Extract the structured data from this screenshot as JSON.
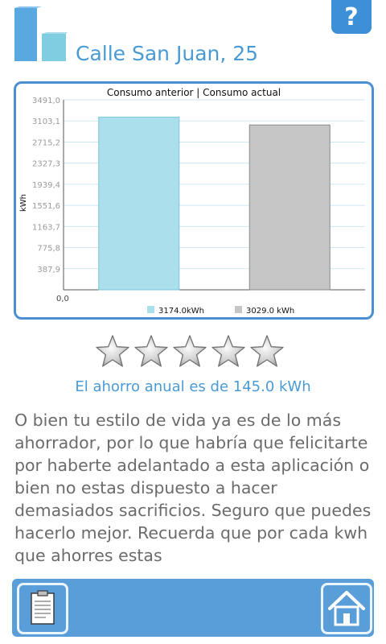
{
  "header": {
    "address": "Calle San Juan, 25",
    "help_label": "?",
    "logo_icon": "bars-logo-icon"
  },
  "chart_data": {
    "type": "bar",
    "title": "Consumo anterior | Consumo actual",
    "ylabel": "kWh",
    "ylim": [
      0,
      3491.0
    ],
    "yticks": [
      "0,0",
      "387,9",
      "775,8",
      "1163,7",
      "1551,6",
      "1939,4",
      "2327,3",
      "2715,2",
      "3103,1",
      "3491,0"
    ],
    "series": [
      {
        "name": "3174.0kWh",
        "value": 3174.0,
        "color": "#acdfec"
      },
      {
        "name": "3029.0 kWh",
        "value": 3029.0,
        "color": "#c6c6c6"
      }
    ],
    "grid": true,
    "legend": "bottom"
  },
  "rating": {
    "filled": 0,
    "max": 5,
    "icon": "star-icon"
  },
  "savings_text": "El ahorro anual es de 145.0 kWh",
  "message": "O bien tu estilo de vida ya es de lo más ahorrador, por lo que habría que felicitarte por haberte adelantado a esta aplicación o bien no estas dispuesto a hacer demasiados sacrificios. Seguro que puedes hacerlo mejor. Recuerda que por cada kwh que ahorres estas",
  "footer": {
    "left_icon": "clipboard-icon",
    "right_icon": "home-icon"
  },
  "colors": {
    "accent": "#4a9ad4",
    "bar_bg": "#5a9ed9",
    "text": "#6b6b6b"
  }
}
